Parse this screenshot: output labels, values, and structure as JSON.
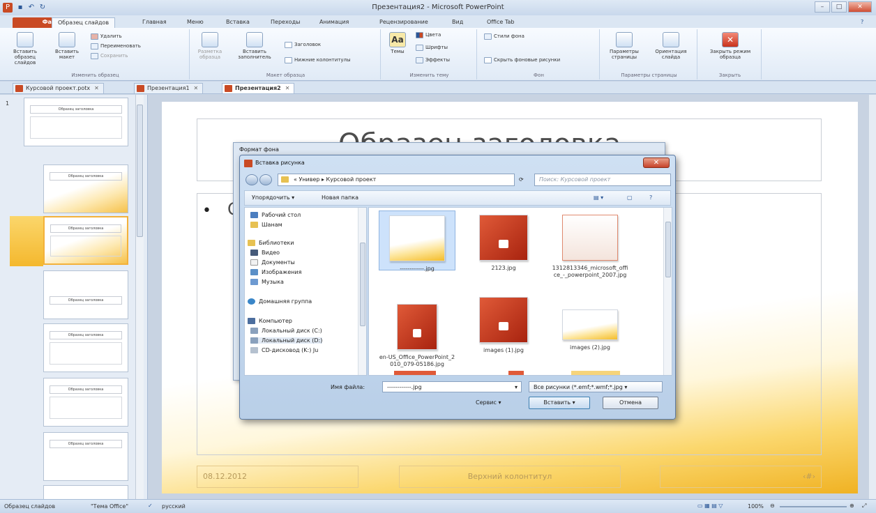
{
  "app": {
    "title": "Презентация2 - Microsoft PowerPoint"
  },
  "ribbon_tabs": [
    "Файл",
    "Образец слайдов",
    "Главная",
    "Меню",
    "Вставка",
    "Переходы",
    "Анимация",
    "Рецензирование",
    "Вид",
    "Office Tab"
  ],
  "ribbon": {
    "insert_master": "Вставить образец слайдов",
    "insert_layout": "Вставить макет",
    "delete": "Удалить",
    "rename": "Переименовать",
    "preserve": "Сохранить",
    "group_edit_master": "Изменить образец",
    "master_layout": "Разметка образца",
    "insert_placeholder": "Вставить заполнитель",
    "title_chk": "Заголовок",
    "footers_chk": "Нижние колонтитулы",
    "group_master_layout": "Макет образца",
    "themes": "Темы",
    "colors": "Цвета",
    "fonts": "Шрифты",
    "effects": "Эффекты",
    "group_edit_theme": "Изменить тему",
    "bg_styles": "Стили фона",
    "hide_bg": "Скрыть фоновые рисунки",
    "group_bg": "Фон",
    "page_setup": "Параметры страницы",
    "orientation": "Ориентация слайда",
    "group_page_setup": "Параметры страницы",
    "close_master": "Закрыть режим образца",
    "group_close": "Закрыть"
  },
  "doc_tabs": [
    "Курсовой проект.potx",
    "Презентация1",
    "Презентация2"
  ],
  "thumbs": {
    "t1_title": "Образец заголовка",
    "t2_title": "Образец заголовка",
    "t3_title": "Образец заголовка",
    "t4_title": "Образец заголовка",
    "t5_title": "Образец заголовка",
    "t6_title": "Образец заголовка",
    "t7_title": "Образец заголовка"
  },
  "slide": {
    "title": "Образец заголовка",
    "date": "08.12.2012",
    "footer": "Верхний колонтитул",
    "number": "‹#›"
  },
  "bg_dialog": {
    "title": "Формат фона"
  },
  "dialog": {
    "title": "Вставка рисунка",
    "crumb": "« Универ ▸ Курсовой проект",
    "search_placeholder": "Поиск: Курсовой проект",
    "organize": "Упорядочить ▾",
    "new_folder": "Новая папка",
    "tree": [
      "Рабочий стол",
      "Шанам",
      "Библиотеки",
      "Видео",
      "Документы",
      "Изображения",
      "Музыка",
      "Домашняя группа",
      "Компьютер",
      "Локальный диск (C:)",
      "Локальный диск (D:)",
      "CD-дисковод (K:) Ju"
    ],
    "files": [
      {
        "name": "------------.jpg"
      },
      {
        "name": "2123.jpg"
      },
      {
        "name": "1312813346_microsoft_office_-_powerpoint_2007.jpg"
      },
      {
        "name": "en-US_Office_PowerPoint_2010_079-05186.jpg"
      },
      {
        "name": "images (1).jpg"
      },
      {
        "name": "images (2).jpg"
      }
    ],
    "filename_label": "Имя файла:",
    "filename_value": "------------.jpg",
    "filetype": "Все рисунки (*.emf;*.wmf;*.jpg",
    "service": "Сервис",
    "insert": "Вставить",
    "cancel": "Отмена"
  },
  "status": {
    "left": "Образец слайдов",
    "theme": "\"Тема Office\"",
    "lang": "русский",
    "zoom": "100%"
  }
}
